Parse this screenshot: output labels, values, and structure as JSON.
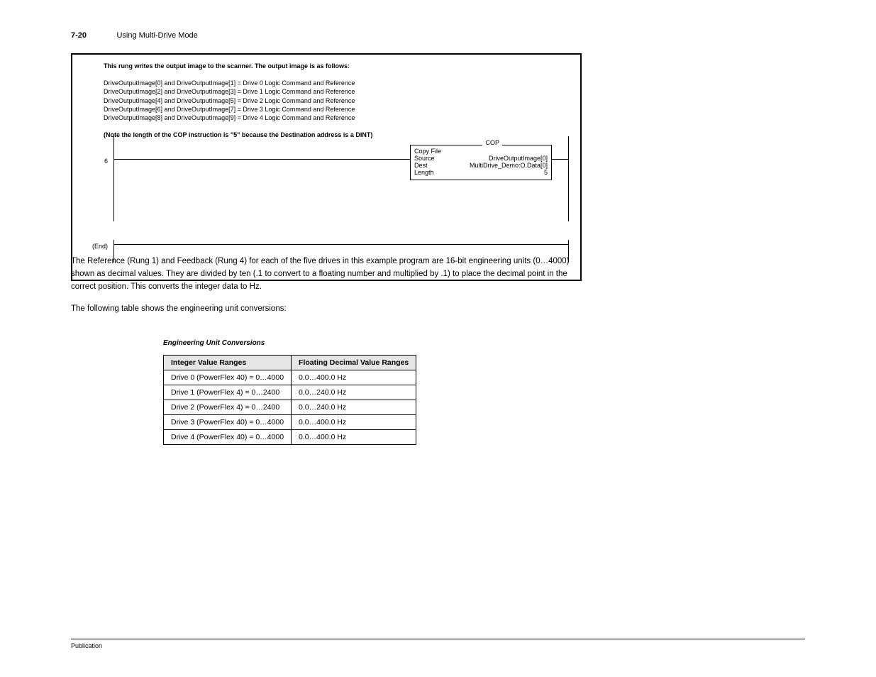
{
  "header": {
    "page_number": "7-20",
    "title": "Using Multi-Drive Mode"
  },
  "ladder": {
    "rung6": {
      "number": "6",
      "comment_intro": "This rung writes the output image to the scanner.  The output image is as follows:",
      "comment_lines": [
        "DriveOutputImage[0] and DriveOutputImage[1] = Drive 0 Logic Command and Reference",
        "DriveOutputImage[2] and DriveOutputImage[3] = Drive 1 Logic Command and Reference",
        "DriveOutputImage[4] and DriveOutputImage[5] = Drive 2 Logic Command and Reference",
        "DriveOutputImage[6] and DriveOutputImage[7] = Drive 3 Logic Command and Reference",
        "DriveOutputImage[8] and DriveOutputImage[9] = Drive 4 Logic Command and Reference"
      ],
      "comment_note": "(Note the length of the COP instruction is \"5\" because the Destination address is a DINT)",
      "cop_label": "COP",
      "cop_name": "Copy File",
      "cop_source_label": "Source",
      "cop_source_value": "DriveOutputImage[0]",
      "cop_dest_label": "Dest",
      "cop_dest_value": "MultiDrive_Demo:O.Data[0]",
      "cop_length_label": "Length",
      "cop_length_value": "5"
    },
    "rung_end": {
      "number": "(End)"
    }
  },
  "body": {
    "p1": "The Reference (Rung 1) and Feedback (Rung 4) for each of the five drives in this example program are 16-bit engineering units (0…4000) shown as decimal values. They are divided by ten (.1 to convert to a floating number and multiplied by .1) to place the decimal point in the correct position. This converts the integer data to Hz.",
    "p2": "The following table shows the engineering unit conversions:"
  },
  "table": {
    "caption": "Engineering Unit Conversions",
    "headers": [
      "Integer Value Ranges",
      "Floating Decimal Value Ranges"
    ],
    "rows": [
      [
        "Drive 0 (PowerFlex 40) = 0…4000",
        "0.0…400.0 Hz"
      ],
      [
        "Drive 1 (PowerFlex 4) = 0…2400",
        "0.0…240.0 Hz"
      ],
      [
        "Drive 2 (PowerFlex 4) = 0…2400",
        "0.0…240.0 Hz"
      ],
      [
        "Drive 3 (PowerFlex 40) = 0…4000",
        "0.0…400.0 Hz"
      ],
      [
        "Drive 4 (PowerFlex 40) = 0…4000",
        "0.0…400.0 Hz"
      ]
    ]
  },
  "footer": {
    "pub": "Publication",
    "date": ""
  }
}
